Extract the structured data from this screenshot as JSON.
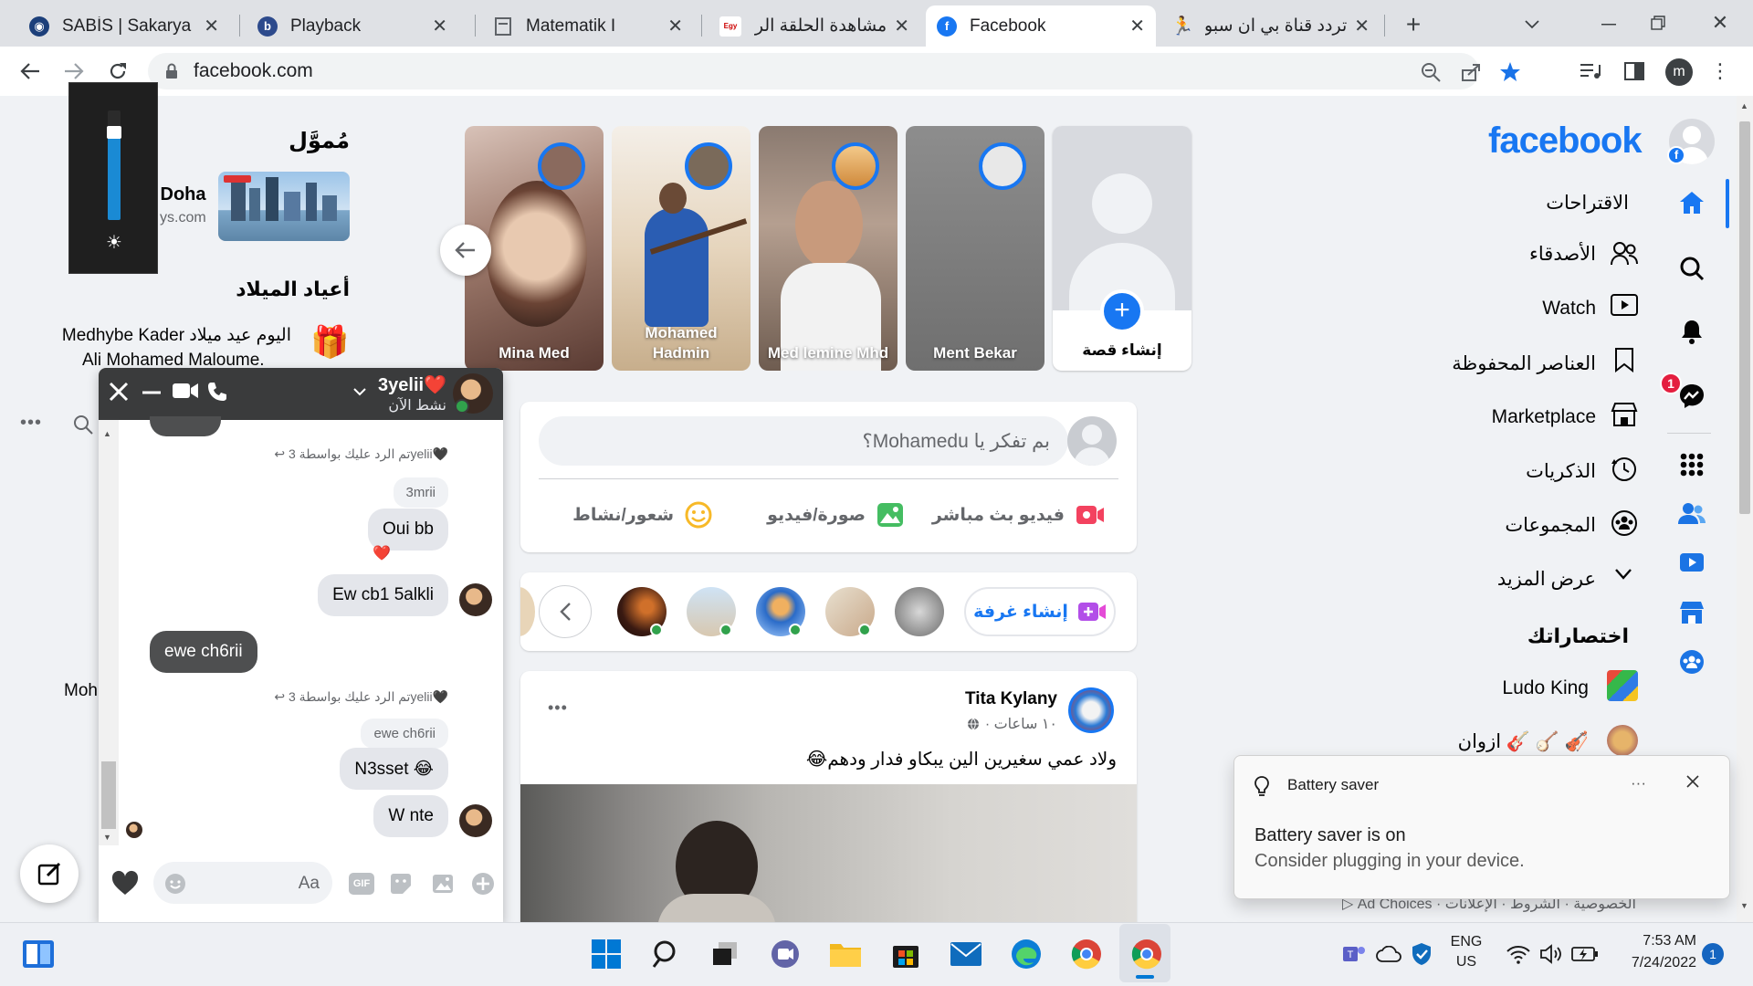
{
  "browser": {
    "tabs": [
      {
        "title": "SABİS | Sakarya Üni",
        "icon": "sabis-globe-icon"
      },
      {
        "title": "Playback",
        "icon": "playback-b-icon"
      },
      {
        "title": "Matematik I",
        "icon": "document-icon"
      },
      {
        "title": "مشاهدة الحلقة الرابع",
        "icon": "egybest-icon"
      },
      {
        "title": "Facebook",
        "icon": "facebook-icon",
        "active": true
      },
      {
        "title": "تردد قناة بي ان سبور",
        "icon": "runner-icon"
      }
    ],
    "url": "facebook.com",
    "profile_initial": "m"
  },
  "brightness_flyout": {
    "level_percent": 80,
    "icon": "sun-icon"
  },
  "sponsored": {
    "heading": "مُموَّل",
    "ad_title": "To Doha",
    "ad_domain": "ys.com"
  },
  "birthdays": {
    "heading": "أعياد الميلاد",
    "line1": "اليوم عيد ميلاد Medhybe Kader",
    "line2": "Ali Mohamed Maloume."
  },
  "contacts_partial": "Moh",
  "stories": {
    "items": [
      {
        "name": "Mina Med"
      },
      {
        "name": "Mohamed Hadmin"
      },
      {
        "name": "Med lemine Mhd"
      },
      {
        "name": "Ment Bekar"
      }
    ],
    "create_label": "إنشاء قصة"
  },
  "composer": {
    "placeholder": "بم تفكر يا Mohamedu؟",
    "live": "فيديو بث مباشر",
    "photo": "صورة/فيديو",
    "feeling": "شعور/نشاط"
  },
  "rooms": {
    "create_room": "إنشاء غرفة"
  },
  "post": {
    "author": "Tita Kylany",
    "meta": "١٠ ساعات ·",
    "text": "ولاد عمي سغيرين الين يبكاو فدار ودهم😂",
    "more": "•••"
  },
  "right_nav": {
    "logo": "facebook",
    "items": [
      {
        "label": "الاقتراحات",
        "icon": "home-icon"
      },
      {
        "label": "الأصدقاء",
        "icon": "friends-icon"
      },
      {
        "label": "Watch",
        "icon": "watch-icon"
      },
      {
        "label": "العناصر المحفوظة",
        "icon": "bookmark-icon"
      },
      {
        "label": "Marketplace",
        "icon": "marketplace-icon"
      },
      {
        "label": "الذكريات",
        "icon": "memories-icon"
      },
      {
        "label": "المجموعات",
        "icon": "groups-icon"
      },
      {
        "label": "عرض المزيد",
        "icon": "chevron-down-icon"
      }
    ],
    "shortcuts_heading": "اختصاراتك",
    "shortcuts": [
      {
        "label": "Ludo King"
      },
      {
        "label": "ازوان 🎸 🪕 🎻"
      }
    ],
    "footer": "الخصوصية · الشروط · الإعلانات · Ad Choices ▷"
  },
  "rail": {
    "messenger_badge": "1"
  },
  "chat": {
    "name": "3yelii❤️",
    "status": "نشط الآن",
    "messages": [
      {
        "kind": "reply",
        "text": "↩ تم الرد عليك بواسطة 3yelii🖤"
      },
      {
        "kind": "quote",
        "text": "3mrii"
      },
      {
        "kind": "in",
        "text": "Oui bb",
        "reaction": "❤️"
      },
      {
        "kind": "in-av",
        "text": "Ew cb1 5alkli"
      },
      {
        "kind": "out",
        "text": "ewe ch6rii"
      },
      {
        "kind": "reply",
        "text": "↩ تم الرد عليك بواسطة 3yelii🖤"
      },
      {
        "kind": "quote",
        "text": "ewe ch6rii"
      },
      {
        "kind": "in",
        "text": "N3sset 😂"
      },
      {
        "kind": "in-av",
        "text": "W nte"
      }
    ],
    "input_placeholder": "Aa",
    "gif": "GIF"
  },
  "toast": {
    "title": "Battery saver",
    "line1": "Battery saver is on",
    "line2": "Consider plugging in your device.",
    "more": "···"
  },
  "taskbar": {
    "lang1": "ENG",
    "lang2": "US",
    "time": "7:53 AM",
    "date": "7/24/2022",
    "notif": "1"
  },
  "colors": {
    "brand": "#1877f2",
    "chat_header": "#3a3b3c",
    "live": "#f3425f",
    "photo": "#45bd62",
    "feeling": "#f7b928"
  }
}
